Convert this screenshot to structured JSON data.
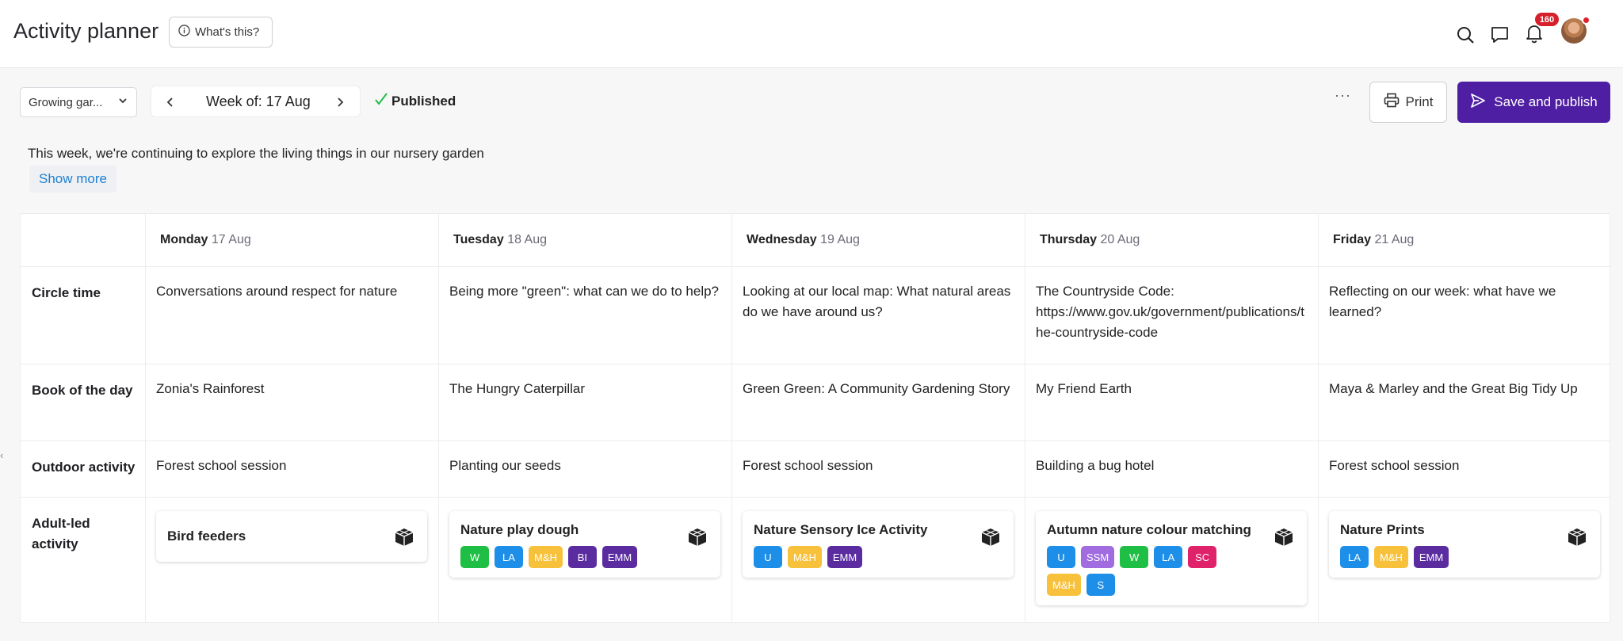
{
  "header": {
    "title": "Activity planner",
    "whats_this": "What's this?",
    "notifications_count": "160"
  },
  "toolbar": {
    "group_select": "Growing gar...",
    "week_prefix": "Week of: ",
    "week_date": "17 Aug",
    "status": "Published",
    "more": "···",
    "print": "Print",
    "save_publish": "Save and publish"
  },
  "intro": {
    "text": "This week, we're continuing to explore the living things in our nursery garden",
    "show_more": "Show more"
  },
  "days": [
    {
      "day": "Monday",
      "date": "17 Aug"
    },
    {
      "day": "Tuesday",
      "date": "18 Aug"
    },
    {
      "day": "Wednesday",
      "date": "19 Aug"
    },
    {
      "day": "Thursday",
      "date": "20 Aug"
    },
    {
      "day": "Friday",
      "date": "21 Aug"
    }
  ],
  "rows": {
    "circle_time": {
      "label": "Circle time",
      "cells": [
        "Conversations around respect for nature",
        "Being more \"green\": what can we do to help?",
        "Looking at our local map: What natural areas do we have around us?",
        "The Countryside Code: https://www.gov.uk/government/publications/the-countryside-code",
        "Reflecting on our week: what have we learned?"
      ]
    },
    "book": {
      "label": "Book of the day",
      "cells": [
        "Zonia's Rainforest",
        "The Hungry Caterpillar",
        "Green Green: A Community Gardening Story",
        "My Friend Earth",
        "Maya & Marley and the Great Big Tidy Up"
      ]
    },
    "outdoor": {
      "label": "Outdoor activity",
      "cells": [
        "Forest school session",
        "Planting our seeds",
        "Forest school session",
        "Building a bug hotel",
        "Forest school session"
      ]
    },
    "adult_led": {
      "label": "Adult-led activity",
      "cards": [
        {
          "title": "Bird feeders",
          "tags": []
        },
        {
          "title": "Nature play dough",
          "tags": [
            "W",
            "LA",
            "M&H",
            "BI",
            "EMM"
          ]
        },
        {
          "title": "Nature Sensory Ice Activity",
          "tags": [
            "U",
            "M&H",
            "EMM"
          ]
        },
        {
          "title": "Autumn nature colour matching",
          "tags": [
            "U",
            "SSM",
            "W",
            "LA",
            "SC",
            "M&H",
            "S"
          ]
        },
        {
          "title": "Nature Prints",
          "tags": [
            "LA",
            "M&H",
            "EMM"
          ]
        }
      ]
    }
  },
  "tag_colors": {
    "W": "#1fbf45",
    "LA": "#1e8fe8",
    "M&H": "#f7c13b",
    "BI": "#5a2ca0",
    "EMM": "#5a2ca0",
    "U": "#1e8fe8",
    "SSM": "#a06ce0",
    "SC": "#e0226a",
    "S": "#1e8fe8"
  },
  "colors": {
    "accent": "#4f1fa3",
    "link": "#1e7fd2",
    "published_check": "#1fbf45",
    "badge": "#d6202b"
  }
}
